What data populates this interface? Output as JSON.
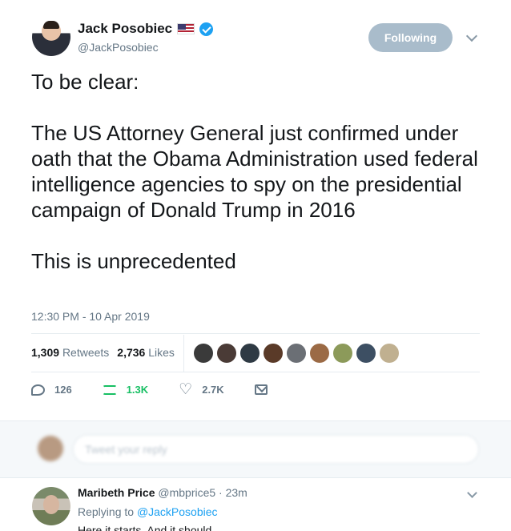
{
  "tweet": {
    "author_name": "Jack Posobiec",
    "author_handle": "@JackPosobiec",
    "follow_label": "Following",
    "paragraphs": [
      "To be clear:",
      "The US Attorney General just confirmed under oath that the Obama Administration used federal intelligence agencies to spy on the presidential campaign of Donald Trump in 2016",
      "This is unprecedented"
    ],
    "timestamp": "12:30 PM - 10 Apr 2019",
    "retweets_count": "1,309",
    "retweets_label": "Retweets",
    "likes_count": "2,736",
    "likes_label": "Likes",
    "reply_action_count": "126",
    "retweet_action_count": "1.3K",
    "like_action_count": "2.7K",
    "liker_colors": [
      "#3a3a3a",
      "#4a3b36",
      "#2f3a44",
      "#5a3a28",
      "#6b6f75",
      "#9b6a45",
      "#8c9a5a",
      "#3d4f63",
      "#c0b090"
    ]
  },
  "reply_box": {
    "placeholder": "Tweet your reply"
  },
  "reply": {
    "name": "Maribeth Price",
    "meta": "@mbprice5 · 23m",
    "replying_label": "Replying to",
    "replying_to": "@JackPosobiec",
    "text": "Here it starts. And it should"
  },
  "colors": {
    "accent": "#1da1f2",
    "retweet_green": "#17bf63",
    "follow_button": "#a9bccb"
  }
}
